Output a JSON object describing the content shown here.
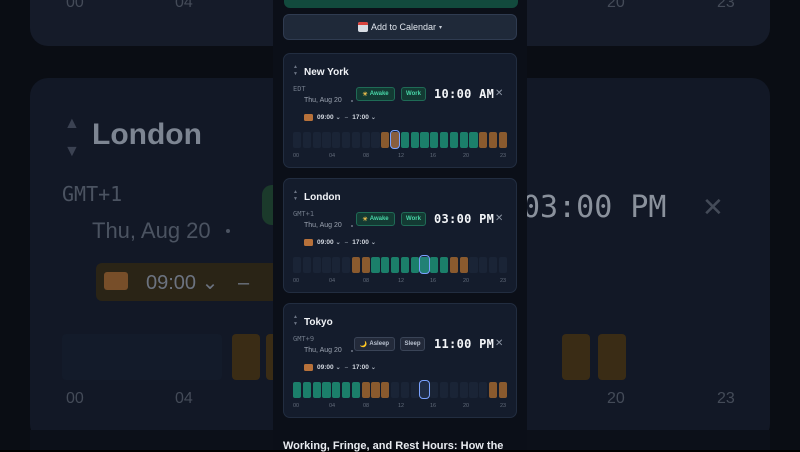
{
  "add_to_calendar": {
    "label": "Add to Calendar",
    "caret": "▾"
  },
  "cards": [
    {
      "city": "New York",
      "tz": "EDT",
      "date": "Thu, Aug 20",
      "status": "Awake",
      "status_icon": "sun-icon",
      "mode": "Work",
      "time": "10:00 AM",
      "start": "09:00",
      "end": "17:00",
      "ticks": [
        "00",
        "04",
        "08",
        "12",
        "16",
        "20",
        "23"
      ],
      "hours": [
        "n",
        "n",
        "n",
        "n",
        "n",
        "n",
        "n",
        "n",
        "n",
        "f",
        "f",
        "w",
        "w",
        "w",
        "w",
        "w",
        "w",
        "w",
        "w",
        "f",
        "f",
        "f"
      ],
      "current_hour": 10
    },
    {
      "city": "London",
      "tz": "GMT+1",
      "date": "Thu, Aug 20",
      "status": "Awake",
      "status_icon": "sun-icon",
      "mode": "Work",
      "time": "03:00 PM",
      "start": "09:00",
      "end": "17:00",
      "ticks": [
        "00",
        "04",
        "08",
        "12",
        "16",
        "20",
        "23"
      ],
      "hours": [
        "n",
        "n",
        "n",
        "n",
        "n",
        "n",
        "f",
        "f",
        "w",
        "w",
        "w",
        "w",
        "w",
        "w",
        "w",
        "w",
        "f",
        "f",
        "n",
        "n",
        "n",
        "n"
      ],
      "current_hour": 13
    },
    {
      "city": "Tokyo",
      "tz": "GMT+9",
      "date": "Thu, Aug 20",
      "status": "Asleep",
      "status_icon": "moon-icon",
      "mode": "Sleep",
      "time": "11:00 PM",
      "start": "09:00",
      "end": "17:00",
      "ticks": [
        "00",
        "04",
        "08",
        "12",
        "16",
        "20",
        "23"
      ],
      "hours": [
        "w",
        "w",
        "w",
        "w",
        "w",
        "w",
        "w",
        "f",
        "f",
        "f",
        "n",
        "n",
        "n",
        "n",
        "n",
        "n",
        "n",
        "n",
        "n",
        "n",
        "f",
        "f"
      ],
      "current_hour": 13
    }
  ],
  "background": {
    "city": "London",
    "tz": "GMT+1",
    "date": "Thu, Aug 20",
    "start": "09:00",
    "end_partial": "1",
    "time": "03:00 PM",
    "ticks": [
      "00",
      "04",
      "20",
      "23"
    ],
    "top_ticks": [
      "00",
      "04",
      "20",
      "23"
    ]
  },
  "section_title": "Working, Fringe, and Rest Hours: How the",
  "colors": {
    "work": "#1b7f6a",
    "fringe": "#8a5a2e",
    "night": "#1a2436",
    "accent": "#7aa2ff"
  }
}
